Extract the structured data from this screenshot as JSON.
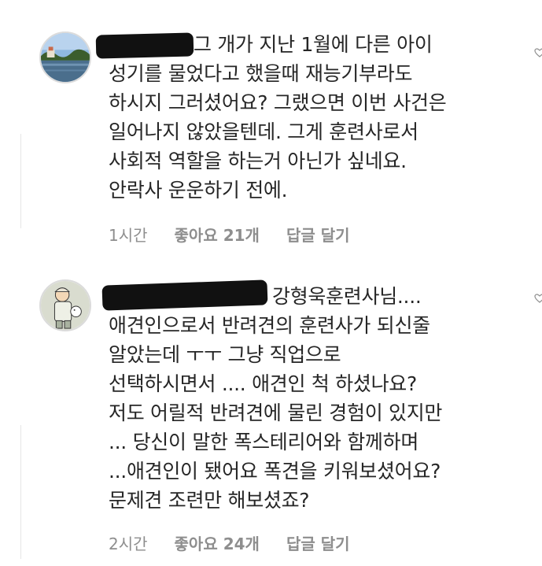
{
  "comments": [
    {
      "text_first_line_suffix": "그 개가 지난 1월에 다른 아이",
      "text_rest": "성기를 물었다고 했을때 재능기부라도\n하시지 그러셨어요? 그랬으면 이번 사건은\n일어나지 않았을텐데. 그게 훈련사로서\n사회적 역할을 하는거 아닌가 싶네요.\n안락사 운운하기 전에.",
      "time": "1시간",
      "likes": "좋아요 21개",
      "reply": "답글 달기",
      "avatar_icon": "lake-landscape-avatar"
    },
    {
      "text_first_line_suffix": "강형욱훈련사님....",
      "text_rest": "애견인으로서 반려견의 훈련사가 되신줄\n알았는데 ㅜㅜ 그냥 직업으로\n선택하시면서 .... 애견인 척 하셨나요?\n저도 어릴적 반려견에 물린 경험이 있지만\n... 당신이 말한 폭스테리어와 함께하며\n...애견인이 됐어요  폭견을 키워보셨어요?\n문제견 조련만 해보셨죠?",
      "time": "2시간",
      "likes": "좋아요 24개",
      "reply": "답글 달기",
      "avatar_icon": "cartoon-character-avatar"
    }
  ],
  "colors": {
    "text": "#262626",
    "meta": "#8e8e8e",
    "redaction": "#111111"
  }
}
